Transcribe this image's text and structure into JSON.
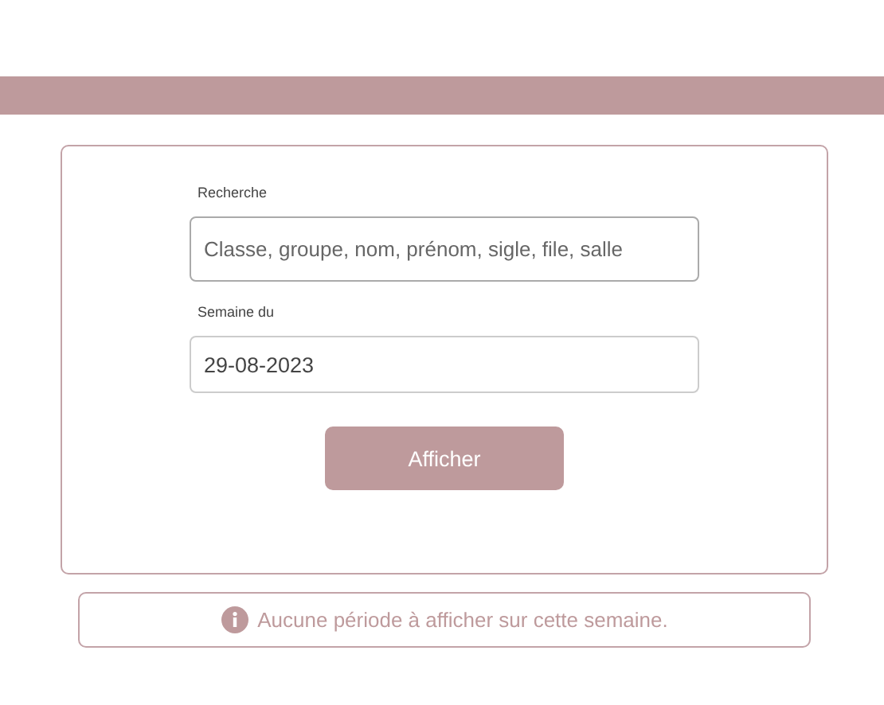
{
  "search": {
    "label": "Recherche",
    "placeholder": "Classe, groupe, nom, prénom, sigle, file, salle"
  },
  "week": {
    "label": "Semaine du",
    "value": "29-08-2023"
  },
  "button": {
    "label": "Afficher"
  },
  "alert": {
    "message": "Aucune période à afficher sur cette semaine."
  }
}
